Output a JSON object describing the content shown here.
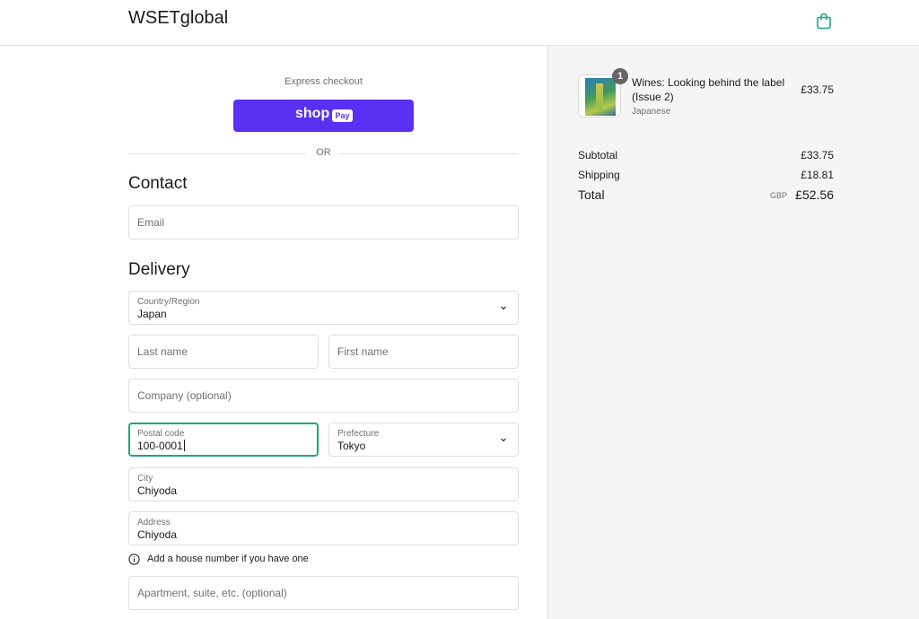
{
  "header": {
    "brand": "WSETglobal",
    "cart_icon": "shopping-bag-icon",
    "accent_color": "#1aa683"
  },
  "express_checkout": {
    "label": "Express checkout",
    "shop_pay": {
      "word": "shop",
      "pill": "Pay",
      "color": "#5a31f4"
    },
    "or_label": "OR"
  },
  "contact": {
    "heading": "Contact",
    "email": {
      "placeholder": "Email",
      "value": ""
    }
  },
  "delivery": {
    "heading": "Delivery",
    "country": {
      "label": "Country/Region",
      "value": "Japan"
    },
    "last_name": {
      "placeholder": "Last name"
    },
    "first_name": {
      "placeholder": "First name"
    },
    "company": {
      "placeholder": "Company (optional)"
    },
    "postal_code": {
      "label": "Postal code",
      "value": "100-0001"
    },
    "prefecture": {
      "label": "Prefecture",
      "value": "Tokyo"
    },
    "city": {
      "label": "City",
      "value": "Chiyoda"
    },
    "address": {
      "label": "Address",
      "value": "Chiyoda"
    },
    "address_hint": "Add a house number if you have one",
    "apartment": {
      "placeholder": "Apartment, suite, etc. (optional)"
    }
  },
  "summary": {
    "items": [
      {
        "title": "Wines: Looking behind the label (Issue 2)",
        "variant": "Japanese",
        "price": "£33.75",
        "quantity": "1"
      }
    ],
    "subtotal": {
      "label": "Subtotal",
      "value": "£33.75"
    },
    "shipping": {
      "label": "Shipping",
      "value": "£18.81"
    },
    "total": {
      "label": "Total",
      "currency": "GBP",
      "value": "£52.56"
    }
  }
}
